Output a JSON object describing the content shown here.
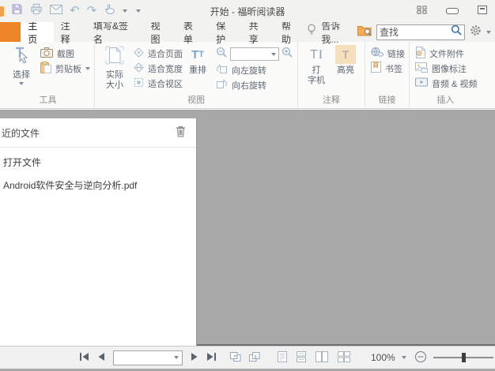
{
  "window": {
    "title": "开始 - 福昕阅读器"
  },
  "quick_access": {
    "icons": [
      "save-icon",
      "print-icon",
      "email-icon",
      "undo-icon",
      "redo-icon",
      "hand-tool-icon",
      "toolbar-more-icon"
    ]
  },
  "window_controls": {
    "icons": [
      "layout-grid-icon",
      "minimize-icon",
      "maximize-icon"
    ]
  },
  "tab_bar": {
    "tabs": [
      {
        "label": "主页",
        "active": true
      },
      {
        "label": "注释"
      },
      {
        "label": "填写&签名"
      },
      {
        "label": "视图"
      },
      {
        "label": "表单"
      },
      {
        "label": "保护"
      },
      {
        "label": "共享"
      },
      {
        "label": "帮助"
      }
    ],
    "tell_me": "告诉我...",
    "search": {
      "placeholder": "查找"
    }
  },
  "ribbon": {
    "groups": [
      {
        "label": "工具"
      },
      {
        "label": "视图"
      },
      {
        "label": "注释"
      },
      {
        "label": "链接"
      },
      {
        "label": "插入"
      }
    ],
    "buttons": {
      "select": "选择",
      "snapshot": "截图",
      "clipboard": "剪贴板",
      "actual_size": "实际\n大小",
      "fit_page": "适合页面",
      "fit_width": "适合宽度",
      "fit_visible": "适合视区",
      "reflow": "重排",
      "zoom_value": "",
      "rotate_left": "向左旋转",
      "rotate_right": "向右旋转",
      "typewriter": "打\n字机",
      "highlight": "高亮",
      "link": "链接",
      "bookmark": "书签",
      "file_attachment": "文件附件",
      "image_annotation": "图像标注",
      "audio_video": "音频 & 视频"
    }
  },
  "icon_glyphs": {
    "undo": "↶",
    "redo": "↷",
    "reflow_a": "T",
    "reflow_b": "T",
    "typewriter_a": "T",
    "typewriter_b": "I",
    "highlight_t": "T"
  },
  "recent_panel": {
    "title": "近的文件",
    "items": [
      {
        "label": "打开文件"
      },
      {
        "label": "Android软件安全与逆向分析.pdf"
      }
    ]
  },
  "status_bar": {
    "page_value": "",
    "zoom_level": "100%"
  },
  "colors": {
    "accent_orange": "#ee8528",
    "icon_blue": "#a5bdd6",
    "doc_background": "#a8a8a8"
  }
}
